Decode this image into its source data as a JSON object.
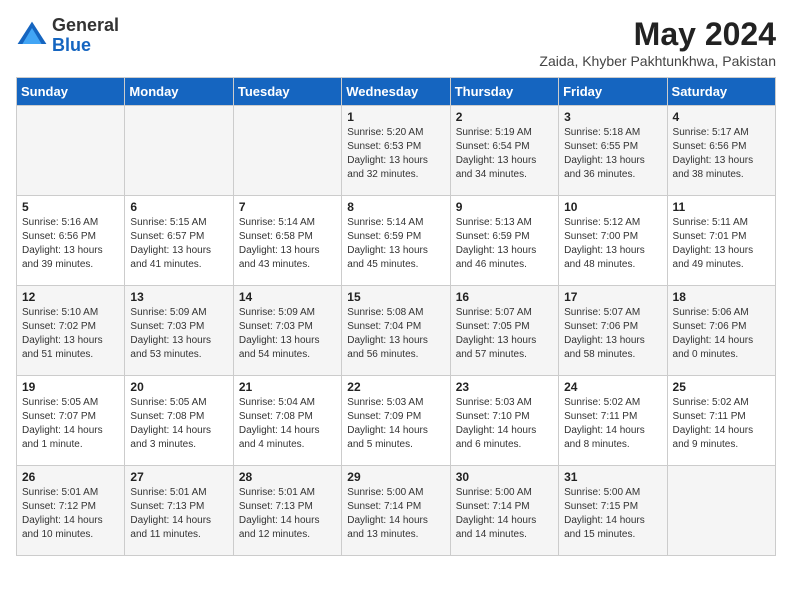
{
  "logo": {
    "general": "General",
    "blue": "Blue"
  },
  "header": {
    "month_year": "May 2024",
    "location": "Zaida, Khyber Pakhtunkhwa, Pakistan"
  },
  "weekdays": [
    "Sunday",
    "Monday",
    "Tuesday",
    "Wednesday",
    "Thursday",
    "Friday",
    "Saturday"
  ],
  "weeks": [
    [
      {
        "day": "",
        "info": ""
      },
      {
        "day": "",
        "info": ""
      },
      {
        "day": "",
        "info": ""
      },
      {
        "day": "1",
        "info": "Sunrise: 5:20 AM\nSunset: 6:53 PM\nDaylight: 13 hours\nand 32 minutes."
      },
      {
        "day": "2",
        "info": "Sunrise: 5:19 AM\nSunset: 6:54 PM\nDaylight: 13 hours\nand 34 minutes."
      },
      {
        "day": "3",
        "info": "Sunrise: 5:18 AM\nSunset: 6:55 PM\nDaylight: 13 hours\nand 36 minutes."
      },
      {
        "day": "4",
        "info": "Sunrise: 5:17 AM\nSunset: 6:56 PM\nDaylight: 13 hours\nand 38 minutes."
      }
    ],
    [
      {
        "day": "5",
        "info": "Sunrise: 5:16 AM\nSunset: 6:56 PM\nDaylight: 13 hours\nand 39 minutes."
      },
      {
        "day": "6",
        "info": "Sunrise: 5:15 AM\nSunset: 6:57 PM\nDaylight: 13 hours\nand 41 minutes."
      },
      {
        "day": "7",
        "info": "Sunrise: 5:14 AM\nSunset: 6:58 PM\nDaylight: 13 hours\nand 43 minutes."
      },
      {
        "day": "8",
        "info": "Sunrise: 5:14 AM\nSunset: 6:59 PM\nDaylight: 13 hours\nand 45 minutes."
      },
      {
        "day": "9",
        "info": "Sunrise: 5:13 AM\nSunset: 6:59 PM\nDaylight: 13 hours\nand 46 minutes."
      },
      {
        "day": "10",
        "info": "Sunrise: 5:12 AM\nSunset: 7:00 PM\nDaylight: 13 hours\nand 48 minutes."
      },
      {
        "day": "11",
        "info": "Sunrise: 5:11 AM\nSunset: 7:01 PM\nDaylight: 13 hours\nand 49 minutes."
      }
    ],
    [
      {
        "day": "12",
        "info": "Sunrise: 5:10 AM\nSunset: 7:02 PM\nDaylight: 13 hours\nand 51 minutes."
      },
      {
        "day": "13",
        "info": "Sunrise: 5:09 AM\nSunset: 7:03 PM\nDaylight: 13 hours\nand 53 minutes."
      },
      {
        "day": "14",
        "info": "Sunrise: 5:09 AM\nSunset: 7:03 PM\nDaylight: 13 hours\nand 54 minutes."
      },
      {
        "day": "15",
        "info": "Sunrise: 5:08 AM\nSunset: 7:04 PM\nDaylight: 13 hours\nand 56 minutes."
      },
      {
        "day": "16",
        "info": "Sunrise: 5:07 AM\nSunset: 7:05 PM\nDaylight: 13 hours\nand 57 minutes."
      },
      {
        "day": "17",
        "info": "Sunrise: 5:07 AM\nSunset: 7:06 PM\nDaylight: 13 hours\nand 58 minutes."
      },
      {
        "day": "18",
        "info": "Sunrise: 5:06 AM\nSunset: 7:06 PM\nDaylight: 14 hours\nand 0 minutes."
      }
    ],
    [
      {
        "day": "19",
        "info": "Sunrise: 5:05 AM\nSunset: 7:07 PM\nDaylight: 14 hours\nand 1 minute."
      },
      {
        "day": "20",
        "info": "Sunrise: 5:05 AM\nSunset: 7:08 PM\nDaylight: 14 hours\nand 3 minutes."
      },
      {
        "day": "21",
        "info": "Sunrise: 5:04 AM\nSunset: 7:08 PM\nDaylight: 14 hours\nand 4 minutes."
      },
      {
        "day": "22",
        "info": "Sunrise: 5:03 AM\nSunset: 7:09 PM\nDaylight: 14 hours\nand 5 minutes."
      },
      {
        "day": "23",
        "info": "Sunrise: 5:03 AM\nSunset: 7:10 PM\nDaylight: 14 hours\nand 6 minutes."
      },
      {
        "day": "24",
        "info": "Sunrise: 5:02 AM\nSunset: 7:11 PM\nDaylight: 14 hours\nand 8 minutes."
      },
      {
        "day": "25",
        "info": "Sunrise: 5:02 AM\nSunset: 7:11 PM\nDaylight: 14 hours\nand 9 minutes."
      }
    ],
    [
      {
        "day": "26",
        "info": "Sunrise: 5:01 AM\nSunset: 7:12 PM\nDaylight: 14 hours\nand 10 minutes."
      },
      {
        "day": "27",
        "info": "Sunrise: 5:01 AM\nSunset: 7:13 PM\nDaylight: 14 hours\nand 11 minutes."
      },
      {
        "day": "28",
        "info": "Sunrise: 5:01 AM\nSunset: 7:13 PM\nDaylight: 14 hours\nand 12 minutes."
      },
      {
        "day": "29",
        "info": "Sunrise: 5:00 AM\nSunset: 7:14 PM\nDaylight: 14 hours\nand 13 minutes."
      },
      {
        "day": "30",
        "info": "Sunrise: 5:00 AM\nSunset: 7:14 PM\nDaylight: 14 hours\nand 14 minutes."
      },
      {
        "day": "31",
        "info": "Sunrise: 5:00 AM\nSunset: 7:15 PM\nDaylight: 14 hours\nand 15 minutes."
      },
      {
        "day": "",
        "info": ""
      }
    ]
  ]
}
